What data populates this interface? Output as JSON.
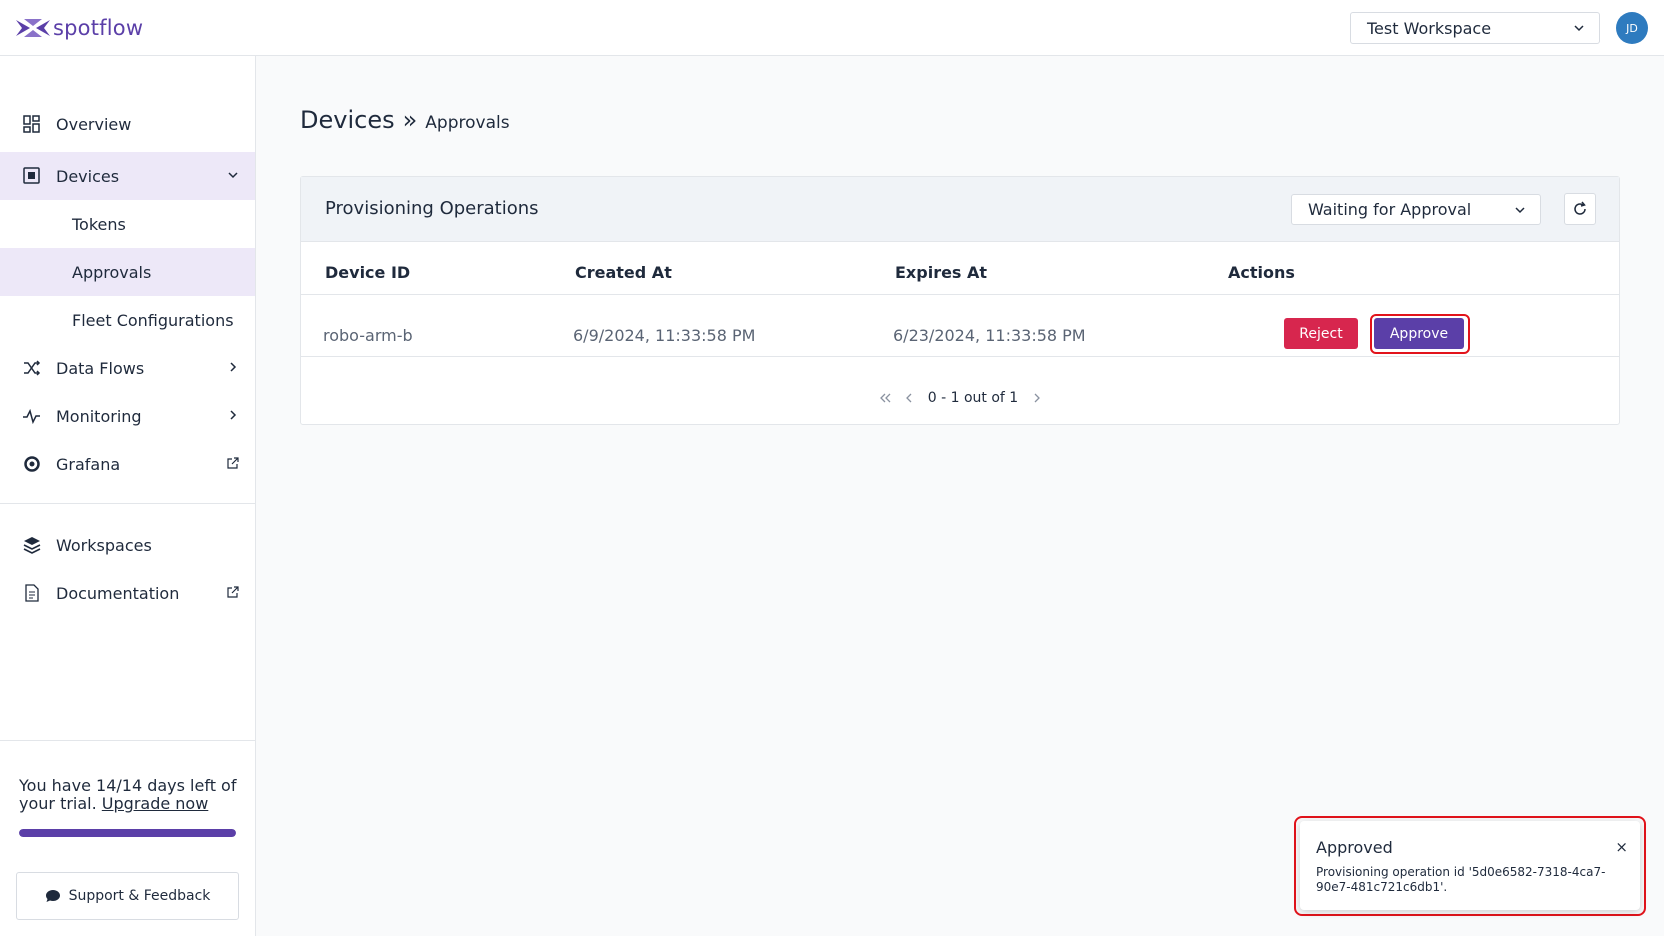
{
  "app": {
    "logo_text": "spotflow",
    "workspace": "Test Workspace",
    "avatar_initials": "JD",
    "brand_color": "#5b3fa8"
  },
  "sidebar": {
    "items": [
      {
        "label": "Overview",
        "icon": "grid-icon"
      },
      {
        "label": "Devices",
        "icon": "chip-icon"
      },
      {
        "label": "Tokens"
      },
      {
        "label": "Approvals"
      },
      {
        "label": "Fleet Configurations"
      },
      {
        "label": "Data Flows",
        "icon": "shuffle-icon"
      },
      {
        "label": "Monitoring",
        "icon": "pulse-icon"
      },
      {
        "label": "Grafana",
        "icon": "grafana-icon"
      },
      {
        "label": "Workspaces",
        "icon": "layers-icon"
      },
      {
        "label": "Documentation",
        "icon": "document-icon"
      }
    ],
    "trial_text": "You have 14/14 days left of your trial.",
    "upgrade_link": "Upgrade now",
    "trial_progress": 1.0,
    "support_label": "Support & Feedback"
  },
  "breadcrumb": {
    "main": "Devices",
    "separator": "»",
    "sub": "Approvals"
  },
  "panel": {
    "title": "Provisioning Operations",
    "filter_value": "Waiting for Approval",
    "columns": [
      "Device ID",
      "Created At",
      "Expires At",
      "Actions"
    ],
    "rows": [
      {
        "device_id": "robo-arm-b",
        "created_at": "6/9/2024, 11:33:58 PM",
        "expires_at": "6/23/2024, 11:33:58 PM",
        "reject_label": "Reject",
        "approve_label": "Approve"
      }
    ],
    "pagination": "0 - 1 out of 1"
  },
  "toast": {
    "title": "Approved",
    "message": "Provisioning operation id '5d0e6582-7318-4ca7-90e7-481c721c6db1'.",
    "close": "×"
  }
}
